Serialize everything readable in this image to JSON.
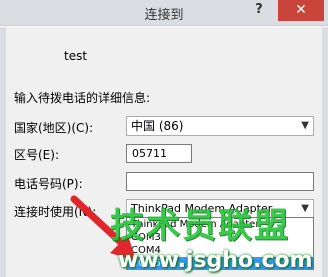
{
  "window": {
    "title": "连接到",
    "help_label": "?",
    "close_label": "✕"
  },
  "connection_name": "test",
  "instruction": "输入待拨电话的详细信息:",
  "fields": {
    "country_label": "国家(地区)(C):",
    "country_value": "中国 (86)",
    "area_label": "区号(E):",
    "area_value": "05711",
    "phone_label": "电话号码(P):",
    "phone_value": "",
    "connect_using_label": "连接时使用(N):",
    "connect_using_value": "ThinkPad Modem Adapter"
  },
  "dropdown": {
    "items": [
      "ThinkPad Modem Adapter",
      "COM3",
      "COM4",
      "COM5"
    ],
    "selected_index": 3
  },
  "watermark": {
    "text": "技术员联盟",
    "url": "www.jsgho.com"
  },
  "colors": {
    "titlebar": "#dadde2",
    "close": "#c9443a",
    "selection": "#3399ff",
    "watermark_green": "#27c43a",
    "arrow_red": "#e0262a"
  }
}
